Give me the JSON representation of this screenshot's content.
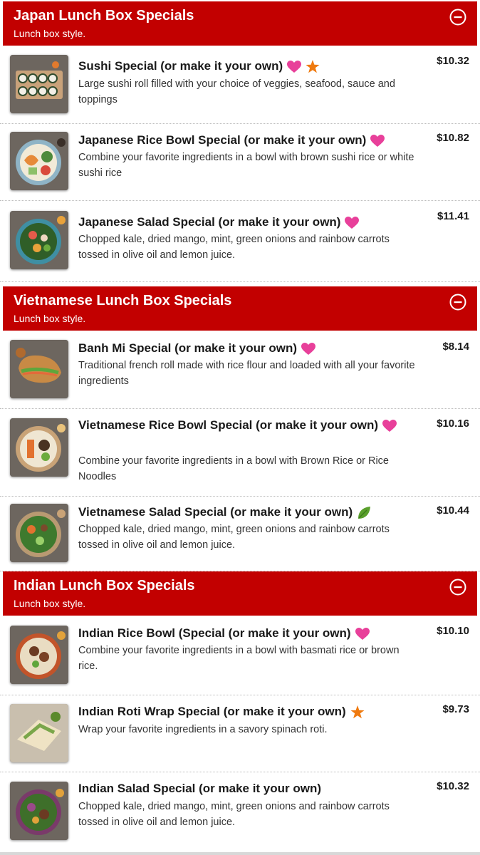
{
  "colors": {
    "header_bg": "#c20000",
    "heart": "#e8409a",
    "star": "#ef7a0f",
    "leaf": "#5aa02c"
  },
  "sections": [
    {
      "title": "Japan Lunch Box Specials",
      "subtitle": "Lunch box style.",
      "collapse_icon": "minus-circle-icon",
      "items": [
        {
          "name": "Sushi Special (or make it your own)",
          "icons": [
            "heart-icon",
            "star-icon"
          ],
          "description": "Large sushi roll filled with your choice of veggies, seafood, sauce and toppings",
          "price": "$10.32"
        },
        {
          "name": "Japanese Rice Bowl Special (or make it your own)",
          "icons": [
            "heart-icon"
          ],
          "description": "Combine your favorite ingredients in a bowl with brown sushi rice or white sushi rice",
          "price": "$10.82"
        },
        {
          "name": "Japanese Salad Special (or make it your own)",
          "icons": [
            "heart-icon"
          ],
          "description": "Chopped kale, dried mango, mint, green onions and rainbow carrots tossed in olive oil and lemon juice.",
          "price": "$11.41"
        }
      ]
    },
    {
      "title": "Vietnamese Lunch Box Specials",
      "subtitle": "Lunch box style.",
      "collapse_icon": "minus-circle-icon",
      "items": [
        {
          "name": "Banh Mi Special (or make it your own)",
          "icons": [
            "heart-icon"
          ],
          "description": "Traditional french roll made with rice flour and loaded with all your favorite ingredients",
          "price": "$8.14"
        },
        {
          "name": "Vietnamese Rice Bowl Special (or make it your own)",
          "icons": [
            "heart-icon"
          ],
          "description": "Combine your favorite ingredients in a bowl with Brown Rice or Rice Noodles",
          "price": "$10.16"
        },
        {
          "name": "Vietnamese Salad Special (or make it your own)",
          "icons": [
            "leaf-icon"
          ],
          "description": "Chopped kale, dried mango, mint, green onions and rainbow carrots tossed in olive oil and lemon juice.",
          "price": "$10.44"
        }
      ]
    },
    {
      "title": "Indian Lunch Box Specials",
      "subtitle": "Lunch box style.",
      "collapse_icon": "minus-circle-icon",
      "items": [
        {
          "name": "Indian Rice Bowl (Special (or make it your own)",
          "icons": [
            "heart-icon"
          ],
          "description": "Combine your favorite ingredients in a bowl with basmati rice or brown rice.",
          "price": "$10.10"
        },
        {
          "name": "Indian Roti Wrap Special (or make it your own)",
          "icons": [
            "star-icon"
          ],
          "description": "Wrap your favorite ingredients in a savory spinach roti.",
          "price": "$9.73"
        },
        {
          "name": "Indian Salad Special (or make it your own)",
          "icons": [],
          "description": "Chopped kale, dried mango, mint, green onions and rainbow carrots tossed in olive oil and lemon juice.",
          "price": "$10.32"
        }
      ]
    }
  ]
}
